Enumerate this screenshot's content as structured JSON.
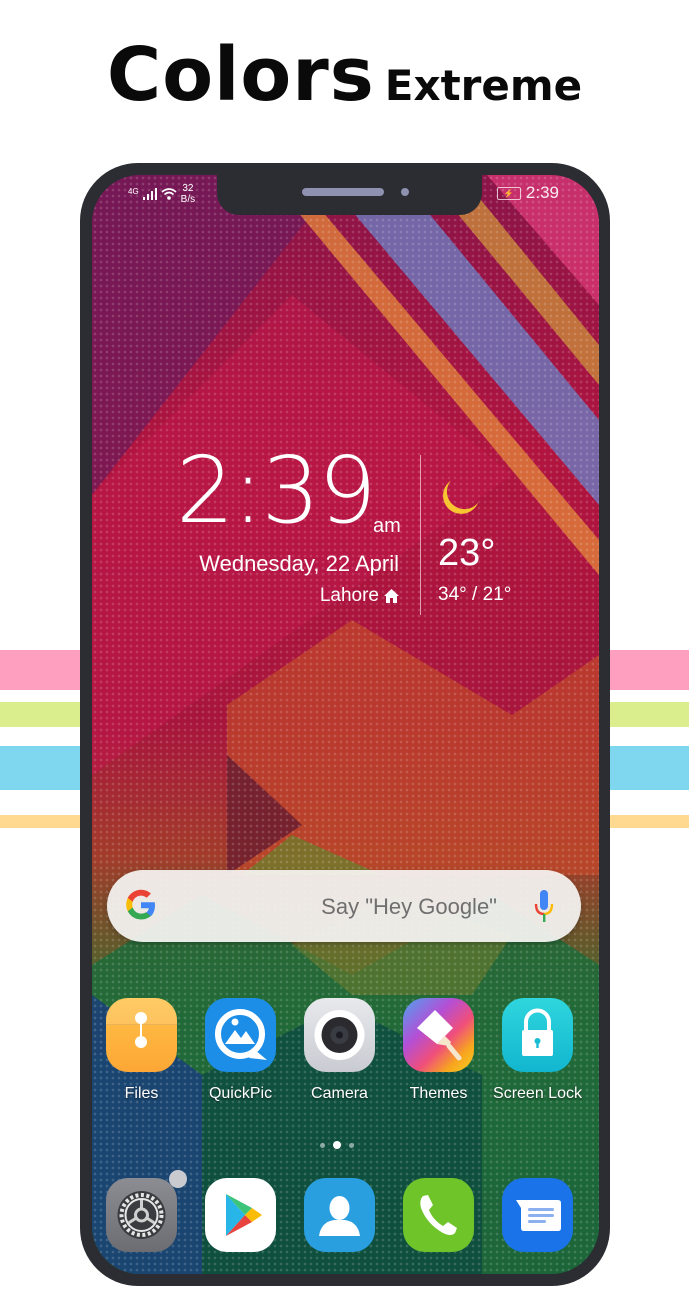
{
  "title": {
    "main": "Colors",
    "sub": "Extreme"
  },
  "colors": {
    "stripe_pink": "#ff9fbf",
    "stripe_green": "#dbee8e",
    "stripe_blue": "#7fd6ef",
    "stripe_orange": "#ffd98f",
    "phone_frame": "#2b2d33"
  },
  "status_bar": {
    "network": "4G",
    "net_speed_value": "32",
    "net_speed_unit": "B/s",
    "time": "2:39",
    "icons": [
      "signal-icon",
      "wifi-icon",
      "battery-charging-icon"
    ]
  },
  "clock": {
    "time": "2:39",
    "ampm": "am",
    "date": "Wednesday, 22 April",
    "city": "Lahore"
  },
  "weather": {
    "icon": "moon-icon",
    "temperature": "23°",
    "range": "34° / 21°"
  },
  "search": {
    "placeholder": "Say \"Hey Google\"",
    "icons": [
      "google-g-icon",
      "microphone-icon"
    ]
  },
  "apps": [
    {
      "label": "Files",
      "icon": "files-icon"
    },
    {
      "label": "QuickPic",
      "icon": "quickpic-icon"
    },
    {
      "label": "Camera",
      "icon": "camera-icon"
    },
    {
      "label": "Themes",
      "icon": "themes-icon"
    },
    {
      "label": "Screen Lock",
      "icon": "lock-icon"
    }
  ],
  "page_indicator": {
    "pages": 3,
    "current": 2
  },
  "dock": [
    {
      "name": "Settings",
      "icon": "settings-gear-icon"
    },
    {
      "name": "Play Store",
      "icon": "play-store-icon"
    },
    {
      "name": "Contacts",
      "icon": "contacts-icon"
    },
    {
      "name": "Phone",
      "icon": "phone-icon"
    },
    {
      "name": "Messages",
      "icon": "messages-icon"
    }
  ]
}
